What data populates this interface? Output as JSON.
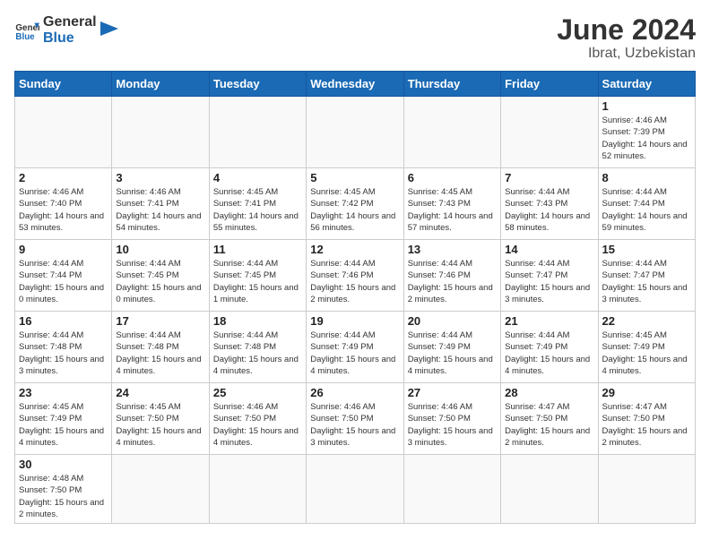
{
  "header": {
    "logo_general": "General",
    "logo_blue": "Blue",
    "month_year": "June 2024",
    "location": "Ibrat, Uzbekistan"
  },
  "days_of_week": [
    "Sunday",
    "Monday",
    "Tuesday",
    "Wednesday",
    "Thursday",
    "Friday",
    "Saturday"
  ],
  "weeks": [
    [
      {
        "day": "",
        "info": ""
      },
      {
        "day": "",
        "info": ""
      },
      {
        "day": "",
        "info": ""
      },
      {
        "day": "",
        "info": ""
      },
      {
        "day": "",
        "info": ""
      },
      {
        "day": "",
        "info": ""
      },
      {
        "day": "1",
        "info": "Sunrise: 4:46 AM\nSunset: 7:39 PM\nDaylight: 14 hours and 52 minutes."
      }
    ],
    [
      {
        "day": "2",
        "info": "Sunrise: 4:46 AM\nSunset: 7:40 PM\nDaylight: 14 hours and 53 minutes."
      },
      {
        "day": "3",
        "info": "Sunrise: 4:46 AM\nSunset: 7:41 PM\nDaylight: 14 hours and 54 minutes."
      },
      {
        "day": "4",
        "info": "Sunrise: 4:45 AM\nSunset: 7:41 PM\nDaylight: 14 hours and 55 minutes."
      },
      {
        "day": "5",
        "info": "Sunrise: 4:45 AM\nSunset: 7:42 PM\nDaylight: 14 hours and 56 minutes."
      },
      {
        "day": "6",
        "info": "Sunrise: 4:45 AM\nSunset: 7:43 PM\nDaylight: 14 hours and 57 minutes."
      },
      {
        "day": "7",
        "info": "Sunrise: 4:44 AM\nSunset: 7:43 PM\nDaylight: 14 hours and 58 minutes."
      },
      {
        "day": "8",
        "info": "Sunrise: 4:44 AM\nSunset: 7:44 PM\nDaylight: 14 hours and 59 minutes."
      }
    ],
    [
      {
        "day": "9",
        "info": "Sunrise: 4:44 AM\nSunset: 7:44 PM\nDaylight: 15 hours and 0 minutes."
      },
      {
        "day": "10",
        "info": "Sunrise: 4:44 AM\nSunset: 7:45 PM\nDaylight: 15 hours and 0 minutes."
      },
      {
        "day": "11",
        "info": "Sunrise: 4:44 AM\nSunset: 7:45 PM\nDaylight: 15 hours and 1 minute."
      },
      {
        "day": "12",
        "info": "Sunrise: 4:44 AM\nSunset: 7:46 PM\nDaylight: 15 hours and 2 minutes."
      },
      {
        "day": "13",
        "info": "Sunrise: 4:44 AM\nSunset: 7:46 PM\nDaylight: 15 hours and 2 minutes."
      },
      {
        "day": "14",
        "info": "Sunrise: 4:44 AM\nSunset: 7:47 PM\nDaylight: 15 hours and 3 minutes."
      },
      {
        "day": "15",
        "info": "Sunrise: 4:44 AM\nSunset: 7:47 PM\nDaylight: 15 hours and 3 minutes."
      }
    ],
    [
      {
        "day": "16",
        "info": "Sunrise: 4:44 AM\nSunset: 7:48 PM\nDaylight: 15 hours and 3 minutes."
      },
      {
        "day": "17",
        "info": "Sunrise: 4:44 AM\nSunset: 7:48 PM\nDaylight: 15 hours and 4 minutes."
      },
      {
        "day": "18",
        "info": "Sunrise: 4:44 AM\nSunset: 7:48 PM\nDaylight: 15 hours and 4 minutes."
      },
      {
        "day": "19",
        "info": "Sunrise: 4:44 AM\nSunset: 7:49 PM\nDaylight: 15 hours and 4 minutes."
      },
      {
        "day": "20",
        "info": "Sunrise: 4:44 AM\nSunset: 7:49 PM\nDaylight: 15 hours and 4 minutes."
      },
      {
        "day": "21",
        "info": "Sunrise: 4:44 AM\nSunset: 7:49 PM\nDaylight: 15 hours and 4 minutes."
      },
      {
        "day": "22",
        "info": "Sunrise: 4:45 AM\nSunset: 7:49 PM\nDaylight: 15 hours and 4 minutes."
      }
    ],
    [
      {
        "day": "23",
        "info": "Sunrise: 4:45 AM\nSunset: 7:49 PM\nDaylight: 15 hours and 4 minutes."
      },
      {
        "day": "24",
        "info": "Sunrise: 4:45 AM\nSunset: 7:50 PM\nDaylight: 15 hours and 4 minutes."
      },
      {
        "day": "25",
        "info": "Sunrise: 4:46 AM\nSunset: 7:50 PM\nDaylight: 15 hours and 4 minutes."
      },
      {
        "day": "26",
        "info": "Sunrise: 4:46 AM\nSunset: 7:50 PM\nDaylight: 15 hours and 3 minutes."
      },
      {
        "day": "27",
        "info": "Sunrise: 4:46 AM\nSunset: 7:50 PM\nDaylight: 15 hours and 3 minutes."
      },
      {
        "day": "28",
        "info": "Sunrise: 4:47 AM\nSunset: 7:50 PM\nDaylight: 15 hours and 2 minutes."
      },
      {
        "day": "29",
        "info": "Sunrise: 4:47 AM\nSunset: 7:50 PM\nDaylight: 15 hours and 2 minutes."
      }
    ],
    [
      {
        "day": "30",
        "info": "Sunrise: 4:48 AM\nSunset: 7:50 PM\nDaylight: 15 hours and 2 minutes."
      },
      {
        "day": "",
        "info": ""
      },
      {
        "day": "",
        "info": ""
      },
      {
        "day": "",
        "info": ""
      },
      {
        "day": "",
        "info": ""
      },
      {
        "day": "",
        "info": ""
      },
      {
        "day": "",
        "info": ""
      }
    ]
  ]
}
